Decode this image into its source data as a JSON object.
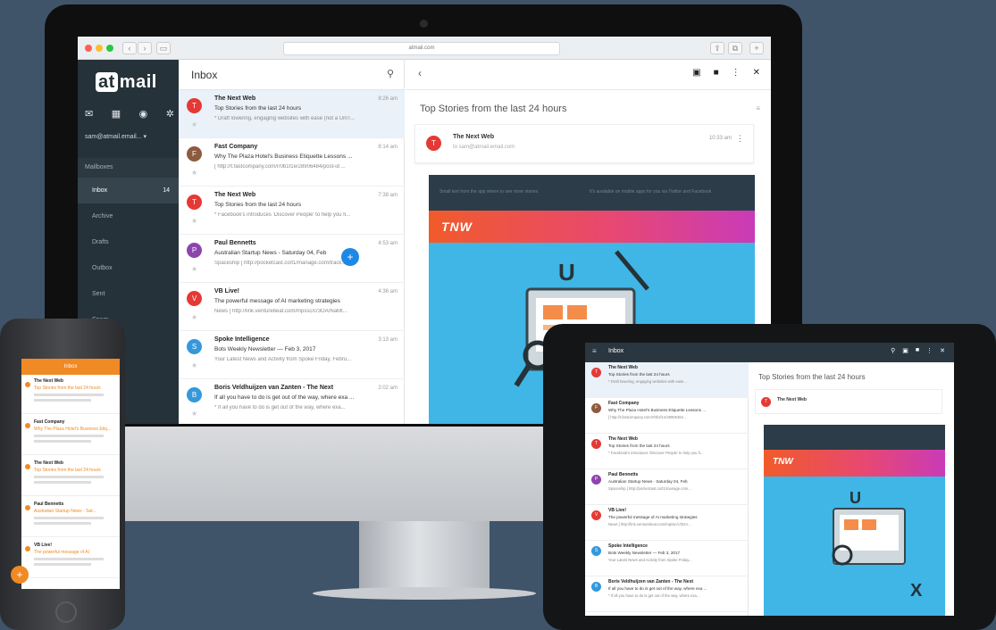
{
  "browser": {
    "url": "atmail.com"
  },
  "sidebar": {
    "logo_at": "at",
    "logo_mail": "mail",
    "account": "sam@atmail.email...",
    "section": "Mailboxes",
    "folders": [
      {
        "label": "Inbox",
        "count": "14"
      },
      {
        "label": "Archive"
      },
      {
        "label": "Drafts"
      },
      {
        "label": "Outbox"
      },
      {
        "label": "Sent"
      },
      {
        "label": "Spam"
      }
    ]
  },
  "list": {
    "title": "Inbox",
    "messages": [
      {
        "initial": "T",
        "color": "#e53935",
        "from": "The Next Web",
        "time": "8:26 am",
        "subject": "Top Stories from the last 24 hours",
        "preview": "* Draft lowering, engaging websites with ease (not a UnIT..."
      },
      {
        "initial": "F",
        "color": "#8d5b3f",
        "from": "Fast Company",
        "time": "8:14 am",
        "subject": "Why The Plaza Hotel's Business Etiquette Lessons ...",
        "preview": "[ http://t.fastcompany.com/r/0b1f1e/28906484/post-id ..."
      },
      {
        "initial": "T",
        "color": "#e53935",
        "from": "The Next Web",
        "time": "7:38 am",
        "subject": "Top Stories from the last 24 hours",
        "preview": "* Facebook's introduces 'Discover People' to help you fi..."
      },
      {
        "initial": "P",
        "color": "#8e44ad",
        "from": "Paul Bennetts",
        "time": "4:53 am",
        "subject": "Australian Startup News - Saturday 04, Feb",
        "preview": "Spaceship [ http://pocketcast.co/t1/manage.com/track..."
      },
      {
        "initial": "V",
        "color": "#e53935",
        "from": "VB Live!",
        "time": "4:36 am",
        "subject": "The powerful message of AI marketing strategies",
        "preview": "News [ http://link.venturebeat.com/mpssc/c/3OA/NaMI..."
      },
      {
        "initial": "S",
        "color": "#3498db",
        "from": "Spoke Intelligence",
        "time": "3:13 am",
        "subject": "Bots Weekly Newsletter — Feb 3, 2017",
        "preview": "Your Latest News and Activity from Spoke Friday, Febru..."
      },
      {
        "initial": "B",
        "color": "#3498db",
        "from": "Boris Veldhuijzen van Zanten - The Next",
        "time": "2:02 am",
        "subject": "If all you have to do is get out of the way, where exa ...",
        "preview": "* If all you have to do is get out of the way, where exa..."
      }
    ]
  },
  "reader": {
    "subject": "Top Stories from the last 24 hours",
    "sender": "The Next Web",
    "sender_initial": "T",
    "to": "to sam@atmail.email.com",
    "time": "10:33 am",
    "newsletter_left": "Small text from the app where to see more stories",
    "newsletter_right": "It's available on mobile apps for you via Twitter and Facebook",
    "brand": "TNW"
  },
  "phone": {
    "header": "Inbox",
    "messages": [
      {
        "from": "The Next Web",
        "subject": "Top Stories from the last 24 hours"
      },
      {
        "from": "Fast Company",
        "subject": "Why The Plaza Hotel's Business Etiq..."
      },
      {
        "from": "The Next Web",
        "subject": "Top Stories from the last 24 hours"
      },
      {
        "from": "Paul Bennetts",
        "subject": "Australian Startup News - Sat..."
      },
      {
        "from": "VB Live!",
        "subject": "The powerful message of AI"
      }
    ],
    "fab": "+"
  },
  "tablet": {
    "title": "Inbox",
    "subject": "Top Stories from the last 24 hours",
    "sender": "The Next Web",
    "brand": "TNW",
    "fab": "+",
    "messages": [
      {
        "initial": "T",
        "color": "#e53935",
        "from": "The Next Web",
        "subject": "Top Stories from the last 24 hours",
        "preview": "* Draft lowering, engaging websites with ease..."
      },
      {
        "initial": "F",
        "color": "#8d5b3f",
        "from": "Fast Company",
        "subject": "Why The Plaza Hotel's Business Etiquette Lessons ...",
        "preview": "[ http://t.fastcompany.com/r/0b1f1e/28906484 ..."
      },
      {
        "initial": "T",
        "color": "#e53935",
        "from": "The Next Web",
        "subject": "Top Stories from the last 24 hours",
        "preview": "* Facebook's introduces 'Discover People' to help you fi..."
      },
      {
        "initial": "P",
        "color": "#8e44ad",
        "from": "Paul Bennetts",
        "subject": "Australian Startup News - Saturday 04, Feb",
        "preview": "Spaceship [ http://pocketcast.co/t1/manage.com..."
      },
      {
        "initial": "V",
        "color": "#e53935",
        "from": "VB Live!",
        "subject": "The powerful message of AI marketing strategies",
        "preview": "News [ http://link.venturebeat.com/mpssc/c/3OA..."
      },
      {
        "initial": "S",
        "color": "#3498db",
        "from": "Spoke Intelligence",
        "subject": "Bots Weekly Newsletter — Feb 3, 2017",
        "preview": "Your Latest News and Activity from Spoke Friday..."
      },
      {
        "initial": "B",
        "color": "#3498db",
        "from": "Boris Veldhuijzen van Zanten - The Next",
        "subject": "If all you have to do is get out of the way, where exa ...",
        "preview": "* If all you have to do is get out of the way, where exa..."
      }
    ]
  },
  "colors": {
    "background": "#3f5468",
    "sidebar": "#26323a",
    "phone_accent": "#f08a24",
    "tnw_orange": "#f15b2a",
    "tnw_pink": "#c93bb8",
    "fab_blue": "#1e88e5"
  }
}
